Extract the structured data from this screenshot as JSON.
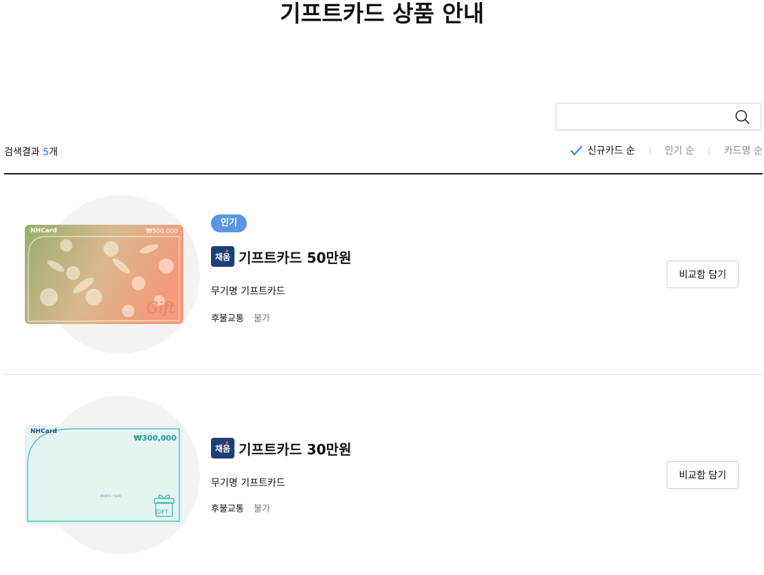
{
  "page": {
    "title": "기프트카드 상품 안내"
  },
  "search": {
    "placeholder": "",
    "value": "",
    "icon": "search-icon"
  },
  "results": {
    "label": "검색결과",
    "count": "5",
    "unit": "개"
  },
  "sort": [
    {
      "label": "신규카드 순",
      "active": true
    },
    {
      "label": "인기 순",
      "active": false
    },
    {
      "label": "카드명 순",
      "active": false
    }
  ],
  "cards": [
    {
      "badge": "인기",
      "logo_text": "채움",
      "name": "기프트카드 50만원",
      "subtitle": "무기명 기프트카드",
      "spec_label": "후불교통",
      "spec_value": "불가",
      "compare_label": "비교함 담기",
      "image": {
        "brand": "NHCard",
        "amount": "₩500,000",
        "script": "Gift"
      }
    },
    {
      "badge": "",
      "logo_text": "채움",
      "name": "기프트카드 30만원",
      "subtitle": "무기명 기프트카드",
      "spec_label": "후불교통",
      "spec_value": "불가",
      "compare_label": "비교함 담기",
      "image": {
        "brand": "NHCard",
        "amount": "₩300,000",
        "mark": "GIFT",
        "expiry": "MONTH / YEAR"
      }
    }
  ],
  "colors": {
    "accent": "#1e6fd9",
    "badge": "#5b95e0",
    "logo": "#1b3f78"
  }
}
